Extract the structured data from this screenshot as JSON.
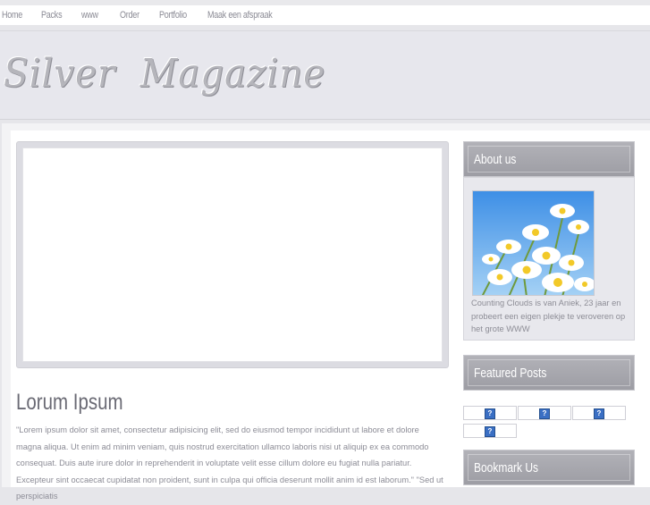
{
  "nav": {
    "items": [
      "Home",
      "Packs",
      "www",
      "Order",
      "Portfolio",
      "Maak een afspraak"
    ]
  },
  "header": {
    "logo_text": "Silver  Magazine"
  },
  "post": {
    "title": "Lorum Ipsum",
    "body": "\"Lorem ipsum dolor sit amet, consectetur adipisicing elit, sed do eiusmod tempor incididunt ut labore et dolore magna aliqua. Ut enim ad minim veniam, quis nostrud exercitation ullamco laboris nisi ut aliquip ex ea commodo consequat. Duis aute irure dolor in reprehenderit in voluptate velit esse cillum dolore eu fugiat nulla pariatur. Excepteur sint occaecat cupidatat non proident, sunt in culpa qui officia deserunt mollit anim id est laborum.\" \"Sed ut perspiciatis"
  },
  "sidebar": {
    "about": {
      "title": "About us",
      "text": "Counting Clouds is van Aniek, 23 jaar en probeert een eigen plekje te veroveren op het grote WWW"
    },
    "featured": {
      "title": "Featured Posts",
      "icon_glyph": "?"
    },
    "bookmark": {
      "title": "Bookmark Us"
    }
  },
  "colors": {
    "background": "#e6e6ea",
    "nav_text": "#8a8a94",
    "widget_header": "#a6a6ad",
    "body_text": "#8c8c96",
    "link_icon": "#3a6fc4"
  }
}
